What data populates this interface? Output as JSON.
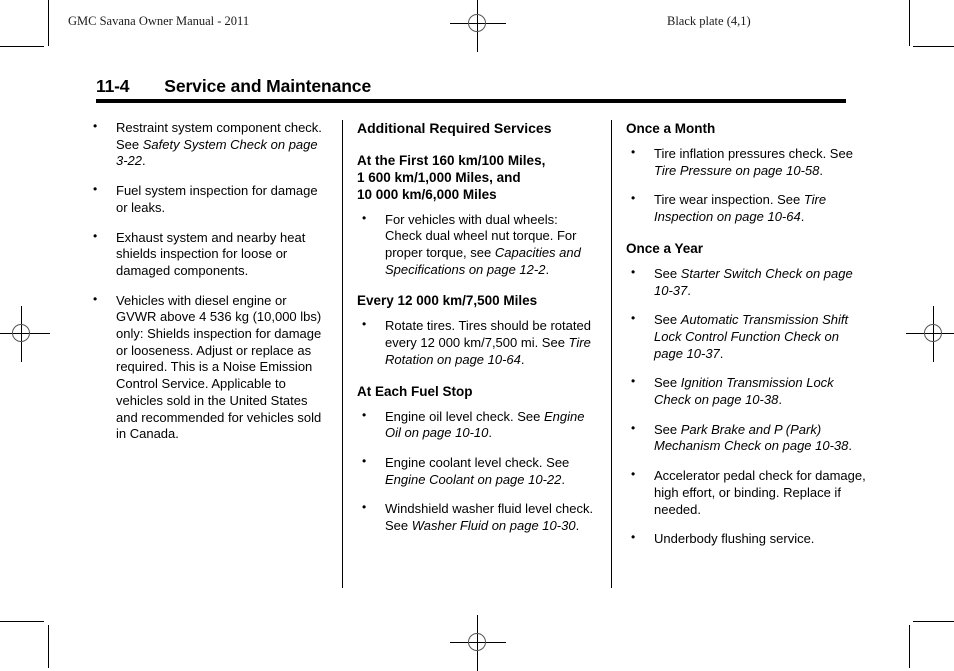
{
  "running_head": {
    "left": "GMC Savana Owner Manual - 2011",
    "right": "Black plate (4,1)"
  },
  "title": {
    "page_number": "11-4",
    "heading": "Service and Maintenance"
  },
  "columns": {
    "left": {
      "bullets": [
        {
          "parts": [
            {
              "text": "Restraint system component check. See ",
              "italic": false
            },
            {
              "text": "Safety System Check on page 3-22",
              "italic": true
            },
            {
              "text": ".",
              "italic": false
            }
          ]
        },
        {
          "parts": [
            {
              "text": "Fuel system inspection for damage or leaks.",
              "italic": false
            }
          ]
        },
        {
          "parts": [
            {
              "text": "Exhaust system and nearby heat shields inspection for loose or damaged components.",
              "italic": false
            }
          ]
        },
        {
          "parts": [
            {
              "text": "Vehicles with diesel engine or GVWR above 4 536 kg (10,000 lbs) only: Shields inspection for damage or looseness. Adjust or replace as required. This is a Noise Emission Control Service. Applicable to vehicles sold in the United States and recommended for vehicles sold in Canada.",
              "italic": false
            }
          ]
        }
      ]
    },
    "middle": {
      "heading": "Additional Required Services",
      "sections": [
        {
          "heading": "At the First 160 km/100 Miles,\n1 600 km/1,000 Miles, and\n10 000 km/6,000 Miles",
          "bullets": [
            {
              "parts": [
                {
                  "text": "For vehicles with dual wheels: Check dual wheel nut torque. For proper torque, see ",
                  "italic": false
                },
                {
                  "text": "Capacities and Specifications on page 12-2",
                  "italic": true
                },
                {
                  "text": ".",
                  "italic": false
                }
              ]
            }
          ]
        },
        {
          "heading": "Every 12 000 km/7,500 Miles",
          "bullets": [
            {
              "parts": [
                {
                  "text": "Rotate tires. Tires should be rotated every 12 000 km/7,500 mi. See ",
                  "italic": false
                },
                {
                  "text": "Tire Rotation on page 10-64",
                  "italic": true
                },
                {
                  "text": ".",
                  "italic": false
                }
              ]
            }
          ]
        },
        {
          "heading": "At Each Fuel Stop",
          "bullets": [
            {
              "parts": [
                {
                  "text": "Engine oil level check. See ",
                  "italic": false
                },
                {
                  "text": "Engine Oil on page 10-10",
                  "italic": true
                },
                {
                  "text": ".",
                  "italic": false
                }
              ]
            },
            {
              "parts": [
                {
                  "text": "Engine coolant level check. See ",
                  "italic": false
                },
                {
                  "text": "Engine Coolant on page 10-22",
                  "italic": true
                },
                {
                  "text": ".",
                  "italic": false
                }
              ]
            },
            {
              "parts": [
                {
                  "text": "Windshield washer fluid level check. See ",
                  "italic": false
                },
                {
                  "text": "Washer Fluid on page 10-30",
                  "italic": true
                },
                {
                  "text": ".",
                  "italic": false
                }
              ]
            }
          ]
        }
      ]
    },
    "right": {
      "sections": [
        {
          "heading": "Once a Month",
          "bullets": [
            {
              "parts": [
                {
                  "text": "Tire inflation pressures check. See ",
                  "italic": false
                },
                {
                  "text": "Tire Pressure on page 10-58",
                  "italic": true
                },
                {
                  "text": ".",
                  "italic": false
                }
              ]
            },
            {
              "parts": [
                {
                  "text": "Tire wear inspection. See ",
                  "italic": false
                },
                {
                  "text": "Tire Inspection on page 10-64",
                  "italic": true
                },
                {
                  "text": ".",
                  "italic": false
                }
              ]
            }
          ]
        },
        {
          "heading": "Once a Year",
          "bullets": [
            {
              "parts": [
                {
                  "text": "See ",
                  "italic": false
                },
                {
                  "text": "Starter Switch Check on page 10-37",
                  "italic": true
                },
                {
                  "text": ".",
                  "italic": false
                }
              ]
            },
            {
              "parts": [
                {
                  "text": "See ",
                  "italic": false
                },
                {
                  "text": "Automatic Transmission Shift Lock Control Function Check on page 10-37",
                  "italic": true
                },
                {
                  "text": ".",
                  "italic": false
                }
              ]
            },
            {
              "parts": [
                {
                  "text": "See ",
                  "italic": false
                },
                {
                  "text": "Ignition Transmission Lock Check on page 10-38",
                  "italic": true
                },
                {
                  "text": ".",
                  "italic": false
                }
              ]
            },
            {
              "parts": [
                {
                  "text": "See ",
                  "italic": false
                },
                {
                  "text": "Park Brake and P (Park) Mechanism Check on page 10-38",
                  "italic": true
                },
                {
                  "text": ".",
                  "italic": false
                }
              ]
            },
            {
              "parts": [
                {
                  "text": "Accelerator pedal check for damage, high effort, or binding. Replace if needed.",
                  "italic": false
                }
              ]
            },
            {
              "parts": [
                {
                  "text": "Underbody flushing service.",
                  "italic": false
                }
              ]
            }
          ]
        }
      ]
    }
  },
  "print_marks": {
    "registration_marks": [
      "top-center",
      "bottom-center",
      "left-middle",
      "right-middle"
    ],
    "crop_marks": [
      "top-left",
      "top-right",
      "bottom-left",
      "bottom-right"
    ]
  }
}
